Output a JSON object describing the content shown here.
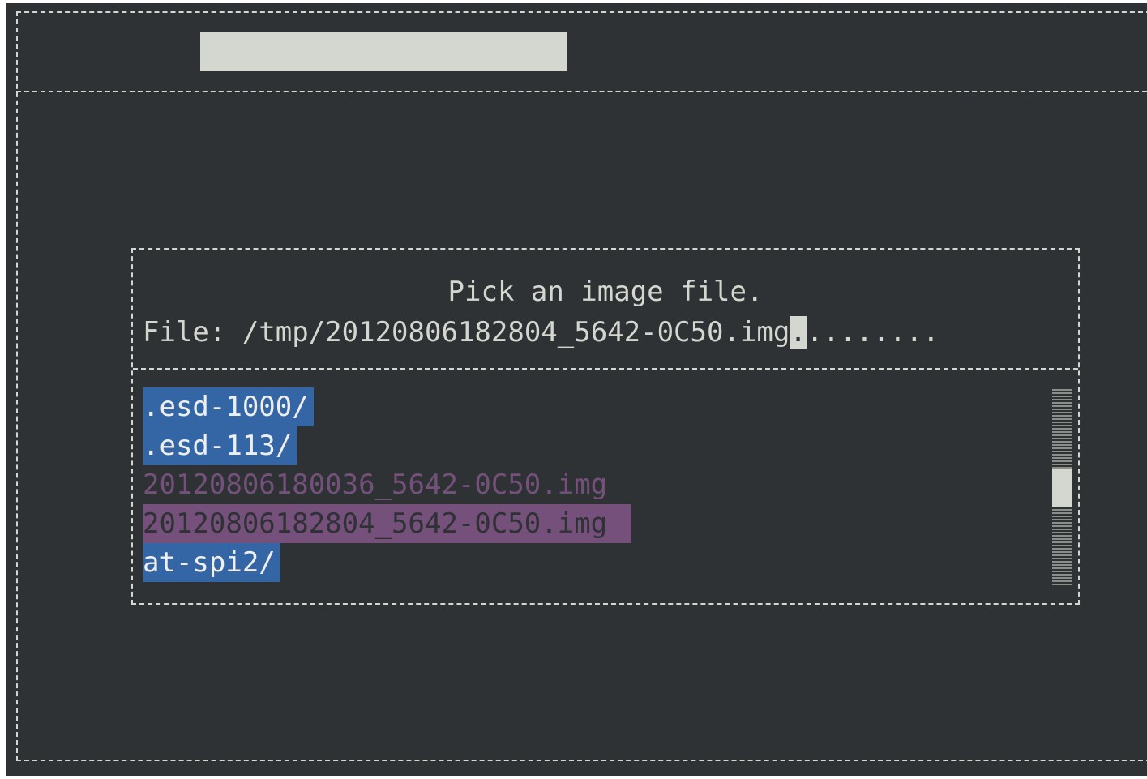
{
  "dialog": {
    "prompt": "Pick an image file.",
    "file_label": "File: ",
    "file_value": "/tmp/20120806182804_5642-0C50.img",
    "cursor_char": ".",
    "trailing_fill": "........"
  },
  "files": [
    {
      "name": ".esd-1000/",
      "kind": "directory"
    },
    {
      "name": ".esd-113/",
      "kind": "directory"
    },
    {
      "name": "20120806180036_5642-0C50.img",
      "kind": "image"
    },
    {
      "name": "20120806182804_5642-0C50.img",
      "kind": "image",
      "selected": true
    },
    {
      "name": "at-spi2/",
      "kind": "directory"
    }
  ],
  "colors": {
    "background": "#2e3234",
    "foreground": "#d3d7cf",
    "directory_highlight": "#3465a4",
    "image_file": "#75507b"
  }
}
